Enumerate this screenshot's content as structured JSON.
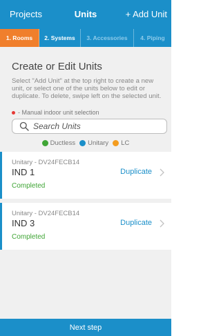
{
  "header": {
    "left_label": "Projects",
    "title": "Units",
    "right_label": "+ Add Unit"
  },
  "steps": [
    {
      "label": "1. Rooms",
      "state": "active"
    },
    {
      "label": "2. Systems",
      "state": "normal"
    },
    {
      "label": "3. Accessories",
      "state": "dim"
    },
    {
      "label": "4. Piping",
      "state": "dim"
    }
  ],
  "main": {
    "title": "Create or Edit Units",
    "instructions": "Select \"Add Unit\" at the top right to create a new unit, or select one of the units below to edit or duplicate. To delete, swipe left on the selected unit.",
    "manual_note": "- Manual indoor unit selection",
    "search_placeholder": "Search Units"
  },
  "legend": [
    {
      "label": "Ductless",
      "color": "#3fa535"
    },
    {
      "label": "Unitary",
      "color": "#1b8fc9"
    },
    {
      "label": "LC",
      "color": "#f39c1f"
    }
  ],
  "units": [
    {
      "model": "Unitary - DV24FECB14",
      "name": "IND 1",
      "status": "Completed",
      "action": "Duplicate"
    },
    {
      "model": "Unitary - DV24FECB14",
      "name": "IND 3",
      "status": "Completed",
      "action": "Duplicate"
    }
  ],
  "footer": {
    "next_label": "Next step"
  },
  "colors": {
    "brand": "#1b8fc9",
    "active_step": "#f07f2c",
    "completed": "#3fa535"
  }
}
